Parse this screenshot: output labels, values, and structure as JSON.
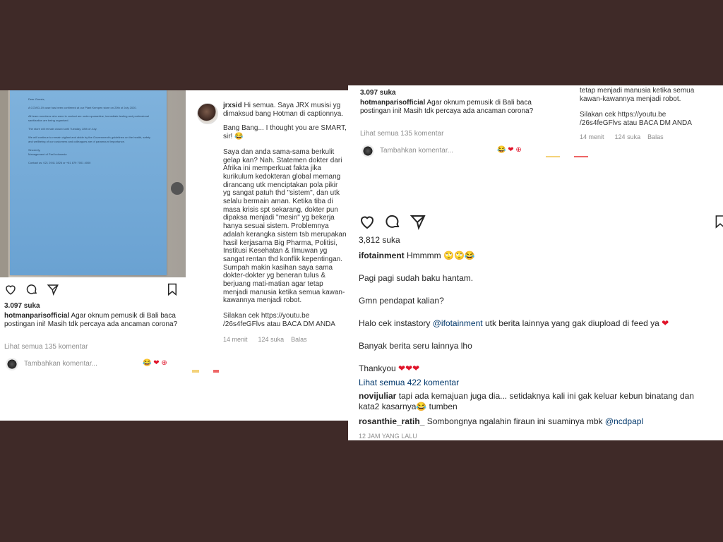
{
  "left": {
    "letter": {
      "lines": [
        "Dear Guests,",
        "A COVID-19 case has been confirmed at our Plant Kempen store on 20th of July 2020.",
        "All team members who were in contact are under quarantine, immediate testing and professional sanitization are being organised.",
        "The store will remain closed until Tuesday, 28th of July.",
        "We will continue to remain vigilant and abide by the Government's guidelines on the health, safety and wellbeing of our customers and colleagues are of paramount importance.",
        "Sincerely,",
        "Management of Pari Indonesia",
        "Contact us: 021 2941 2826 or +61 879 7001 4000"
      ]
    },
    "comment_user": "jrxsid",
    "comment_paragraphs": [
      "Hi semua. Saya JRX musisi yg dimaksud bang Hotman di captionnya.",
      "Bang Bang... I thought you are SMART, sir! 😂",
      "Saya dan anda sama-sama berkulit gelap kan? Nah. Statemen dokter dari Afrika ini memperkuat fakta jika kurikulum kedokteran global memang dirancang utk menciptakan pola pikir yg sangat patuh thd \"sistem\", dan utk selalu bermain aman. Ketika tiba di masa krisis spt sekarang, dokter pun dipaksa menjadi \"mesin\" yg bekerja hanya sesuai sistem. Problemnya adalah kerangka sistem tsb merupakan hasil kerjasama Big Pharma, Politisi, Institusi Kesehatan & Ilmuwan yg sangat rentan thd konflik kepentingan. Sumpah makin kasihan saya sama dokter-dokter yg beneran tulus & berjuang mati-matian agar tetap menjadi manusia ketika semua kawan-kawannya menjadi robot.",
      "Silakan cek https://youtu.be /26s4feGFlvs atau BACA DM ANDA"
    ],
    "comment_meta": [
      "14 menit",
      "124 suka",
      "Balas"
    ],
    "likes": "3.097 suka",
    "caption_user": "hotmanparisofficial",
    "caption_text": "Agar oknum pemusik di Bali baca postingan ini! Masih tdk percaya ada ancaman corona?",
    "view_comments": "Lihat semua 135 komentar",
    "add_comment_placeholder": "Tambahkan komentar...",
    "reactions": "😂 ❤ ⊕"
  },
  "right": {
    "top_left": {
      "likes": "3.097 suka",
      "caption_user": "hotmanparisofficial",
      "caption_text": "Agar oknum pemusik di Bali baca postingan ini! Masih tdk percaya ada ancaman corona?",
      "view_comments": "Lihat semua 135 komentar",
      "add_comment_placeholder": "Tambahkan komentar...",
      "reactions": "😂 ❤ ⊕"
    },
    "top_right": {
      "text1": "tetap menjadi manusia ketika semua kawan-kawannya menjadi robot.",
      "text2": "Silakan cek https://youtu.be /26s4feGFlvs atau BACA DM ANDA",
      "meta": [
        "14 menit",
        "124 suka",
        "Balas"
      ]
    },
    "likes": "3,812 suka",
    "caption_user": "ifotainment",
    "caption_text": "Hmmmm 🙄🙄😂",
    "paragraphs": [
      "Pagi pagi sudah baku hantam.",
      "Gmn pendapat kalian?"
    ],
    "insta_prefix": "Halo cek instastory",
    "insta_mention": "@ifotainment",
    "insta_suffix": "utk berita lainnya yang gak diupload di feed ya",
    "heart1": "❤",
    "more_news": "Banyak berita seru lainnya lho",
    "thanks": "Thankyou",
    "hearts3": "❤❤❤",
    "view_comments": "Lihat semua 422 komentar",
    "comments": [
      {
        "user": "novijuliar",
        "text": "tapi ada kemajuan juga dia... setidaknya kali ini gak keluar kebun binatang dan kata2 kasarnya😂 tumben"
      },
      {
        "user": "rosanthie_ratih_",
        "text": "Sombongnya ngalahin firaun ini suaminya mbk",
        "mention": "@ncdpapl"
      }
    ],
    "timestamp": "12 JAM YANG LALU"
  }
}
